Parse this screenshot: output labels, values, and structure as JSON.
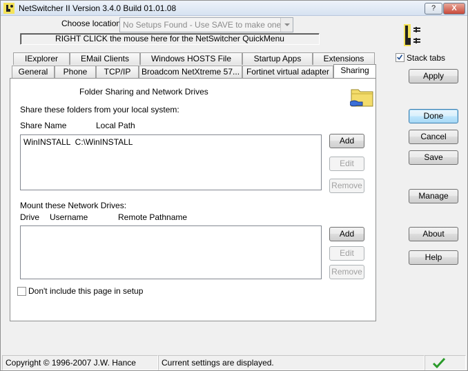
{
  "window": {
    "title": "NetSwitcher II Version 3.4.0 Build 01.01.08",
    "help_btn": "?",
    "close_btn": "X"
  },
  "location": {
    "label": "Choose location:",
    "value": "No Setups Found - Use SAVE to make one..."
  },
  "quickmenu": "RIGHT CLICK the mouse here for the NetSwitcher QuickMenu",
  "tabs_row1": [
    "IExplorer",
    "EMail Clients",
    "Windows HOSTS File",
    "Startup Apps",
    "Extensions"
  ],
  "tabs_row2": [
    "General",
    "Phone",
    "TCP/IP",
    "Broadcom NetXtreme 57...",
    "Fortinet virtual adapter",
    "Sharing"
  ],
  "sharing": {
    "heading": "Folder Sharing and Network Drives",
    "share_label": "Share these folders from your local system:",
    "col_share_name": "Share Name",
    "col_local_path": "Local Path",
    "share_items": [
      "WinINSTALL  C:\\WinINSTALL"
    ],
    "add": "Add",
    "edit": "Edit",
    "remove": "Remove",
    "mount_label": "Mount these Network Drives:",
    "col_drive": "Drive",
    "col_username": "Username",
    "col_remote": "Remote Pathname",
    "exclude_label": "Don't include this page in setup",
    "exclude_checked": false
  },
  "right": {
    "stack_tabs": "Stack tabs",
    "stack_tabs_checked": true,
    "apply": "Apply",
    "done": "Done",
    "cancel": "Cancel",
    "save": "Save",
    "manage": "Manage",
    "about": "About",
    "help": "Help"
  },
  "status": {
    "copyright": "Copyright © 1996-2007 J.W. Hance",
    "message": "Current settings are displayed."
  },
  "colors": {
    "ok_check": "#2a9b2a",
    "folder": "#f3dc6b"
  }
}
